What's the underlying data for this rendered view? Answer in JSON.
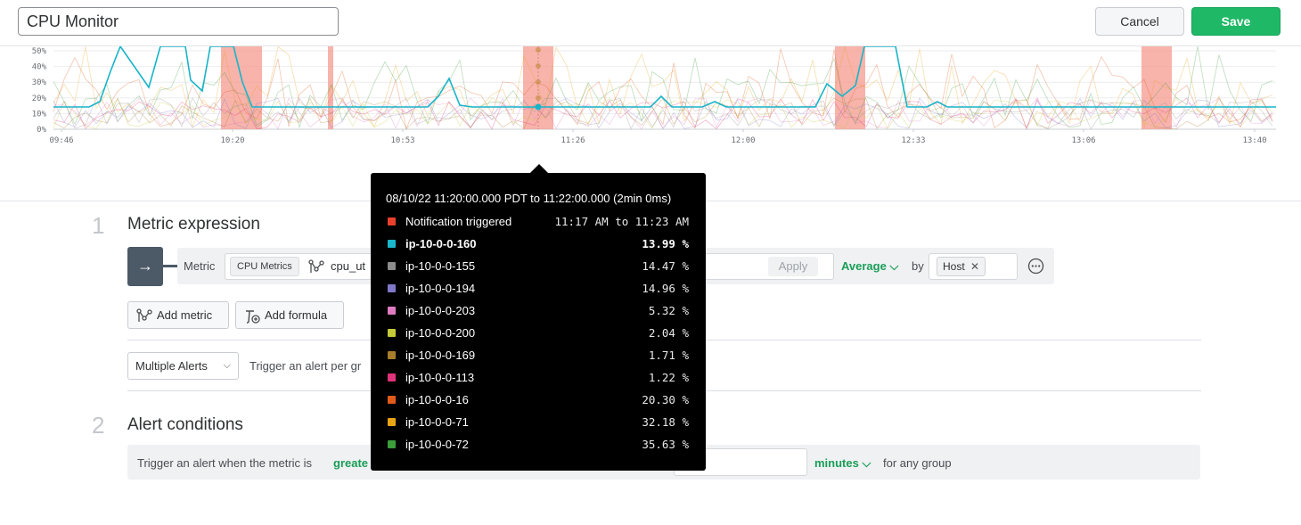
{
  "header": {
    "title_value": "CPU Monitor",
    "cancel_label": "Cancel",
    "save_label": "Save"
  },
  "chart": {
    "y_ticks": [
      "50%",
      "40%",
      "30%",
      "20%",
      "10%",
      "0%"
    ],
    "x_ticks": [
      "09:46",
      "10:20",
      "10:53",
      "11:26",
      "12:00",
      "12:33",
      "13:06",
      "13:40"
    ],
    "colors": {
      "highlight_series": "#18b4c9",
      "alert_band": "#f5998f"
    }
  },
  "tooltip": {
    "range": "08/10/22 11:20:00.000 PDT to 11:22:00.000 (2min 0ms)",
    "notification": {
      "label": "Notification triggered",
      "value": "11:17 AM to 11:23 AM",
      "color": "#e8412b"
    },
    "rows": [
      {
        "name": "ip-10-0-0-160",
        "value": "13.99 %",
        "color": "#19b8cc"
      },
      {
        "name": "ip-10-0-0-155",
        "value": "14.47 %",
        "color": "#8c8c8c"
      },
      {
        "name": "ip-10-0-0-194",
        "value": "14.96 %",
        "color": "#8077c9"
      },
      {
        "name": "ip-10-0-0-203",
        "value": "5.32 %",
        "color": "#e07bc1"
      },
      {
        "name": "ip-10-0-0-200",
        "value": "2.04 %",
        "color": "#c4c93a"
      },
      {
        "name": "ip-10-0-0-169",
        "value": "1.71 %",
        "color": "#a87d2b"
      },
      {
        "name": "ip-10-0-0-113",
        "value": "1.22 %",
        "color": "#e0337a"
      },
      {
        "name": "ip-10-0-0-16",
        "value": "20.30 %",
        "color": "#e05a1a"
      },
      {
        "name": "ip-10-0-0-71",
        "value": "32.18 %",
        "color": "#e8a416"
      },
      {
        "name": "ip-10-0-0-72",
        "value": "35.63 %",
        "color": "#3b9e3b"
      }
    ]
  },
  "section1": {
    "number": "1",
    "title": "Metric expression",
    "metric_label": "Metric",
    "metric_tag": "CPU Metrics",
    "metric_name": "cpu_ut",
    "apply_label": "Apply",
    "aggregation": "Average",
    "by_label": "by",
    "group_tag": "Host",
    "add_metric_label": "Add metric",
    "add_formula_label": "Add formula",
    "alert_mode": "Multiple Alerts",
    "alert_mode_hint": "Trigger an alert per gr"
  },
  "section2": {
    "number": "2",
    "title": "Alert conditions",
    "condition_prefix": "Trigger an alert when the metric is",
    "condition_op": "greate",
    "unit": "minutes",
    "suffix": "for any group"
  }
}
